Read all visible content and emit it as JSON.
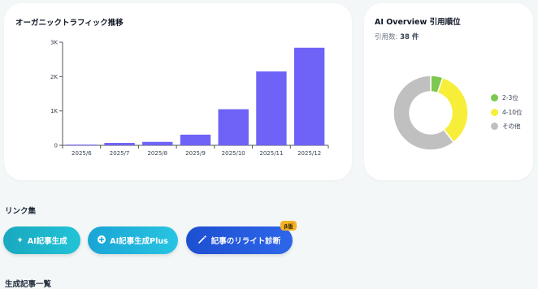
{
  "traffic_card": {
    "title": "オーガニックトラフィック推移"
  },
  "citation_card": {
    "title": "AI Overview 引用順位",
    "count_label": "引用数: ",
    "count_value": "38 件"
  },
  "links": {
    "section_title": "リンク集",
    "buttons": [
      {
        "label": "AI記事生成",
        "icon": "sparkle-icon"
      },
      {
        "label": "AI記事生成Plus",
        "icon": "plus-circle-icon"
      },
      {
        "label": "記事のリライト診断",
        "icon": "magic-wand-icon"
      }
    ],
    "beta_badge": "β版"
  },
  "articles": {
    "section_title": "生成記事一覧"
  },
  "colors": {
    "bar": "#6e63f6",
    "donut_green": "#7ec850",
    "donut_yellow": "#f7ee3a",
    "donut_gray": "#c0c0c0"
  },
  "chart_data": [
    {
      "type": "bar",
      "title": "オーガニックトラフィック推移",
      "categories": [
        "2025/6",
        "2025/7",
        "2025/8",
        "2025/9",
        "2025/10",
        "2025/11",
        "2025/12"
      ],
      "values": [
        20,
        70,
        100,
        310,
        1050,
        2150,
        2840
      ],
      "ylim": [
        0,
        3000
      ],
      "yticks": [
        0,
        1000,
        2000,
        3000
      ],
      "ytick_labels": [
        "0",
        "1K",
        "2K",
        "3K"
      ],
      "xlabel": "",
      "ylabel": "",
      "grid": false
    },
    {
      "type": "pie",
      "donut": true,
      "labels": [
        "2-3位",
        "4-10位",
        "その他"
      ],
      "values": [
        2,
        13,
        23
      ],
      "colors": [
        "#7ec850",
        "#f7ee3a",
        "#c0c0c0"
      ],
      "legend": "right"
    }
  ]
}
